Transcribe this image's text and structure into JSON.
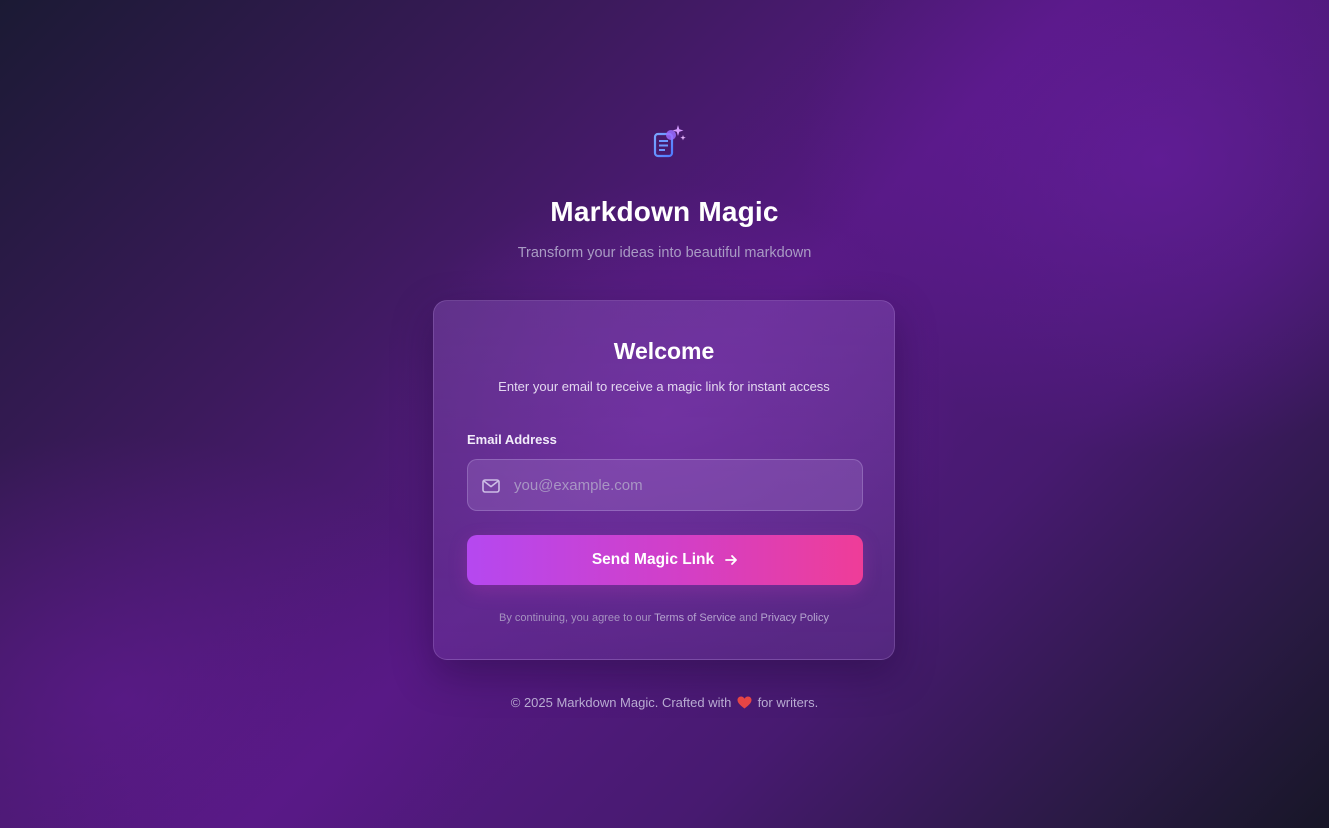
{
  "header": {
    "logo_icon": "document-sparkle-icon",
    "title": "Markdown Magic",
    "subtitle": "Transform your ideas into beautiful markdown"
  },
  "login_card": {
    "title": "Welcome",
    "description": "Enter your email to receive a magic link for instant access",
    "email_field": {
      "label": "Email Address",
      "placeholder": "you@example.com",
      "value": "",
      "icon": "mail-icon"
    },
    "submit_button": {
      "label": "Send Magic Link",
      "icon": "arrow-right-icon"
    },
    "legal": {
      "prefix": "By continuing, you agree to our ",
      "terms_link": "Terms of Service",
      "conjunction": " and ",
      "privacy_link": "Privacy Policy"
    }
  },
  "footer": {
    "text_before": "© 2025 Markdown Magic. Crafted with",
    "heart_icon": "heart-icon",
    "text_after": "for writers."
  },
  "colors": {
    "accent_start": "#b548f0",
    "accent_end": "#ef3d98",
    "logo_blue": "#5b8cff",
    "heart_red": "#e64545"
  }
}
